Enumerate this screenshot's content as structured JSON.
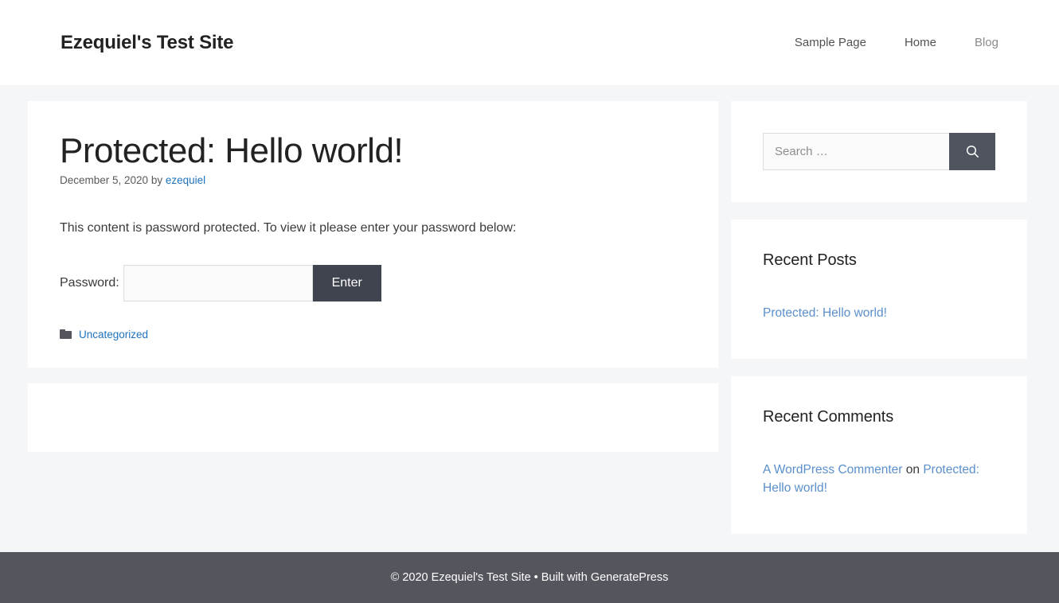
{
  "header": {
    "site_title": "Ezequiel's Test Site",
    "nav": [
      {
        "label": "Sample Page",
        "muted": false
      },
      {
        "label": "Home",
        "muted": false
      },
      {
        "label": "Blog",
        "muted": true
      }
    ]
  },
  "article": {
    "title": "Protected: Hello world!",
    "meta_date": "December 5, 2020",
    "meta_by": "by",
    "meta_author": "ezequiel",
    "protected_notice": "This content is password protected. To view it please enter your password below:",
    "password_label": "Password:",
    "password_value": "",
    "password_placeholder": "",
    "submit_label": "Enter",
    "category_icon": "folder-icon",
    "category_label": "Uncategorized"
  },
  "sidebar": {
    "search": {
      "placeholder": "Search …",
      "value": "",
      "button_icon": "search-icon"
    },
    "recent_posts": {
      "title": "Recent Posts",
      "items": [
        {
          "label": "Protected: Hello world!"
        }
      ]
    },
    "recent_comments": {
      "title": "Recent Comments",
      "items": [
        {
          "author": "A WordPress Commenter",
          "connector": "on",
          "post": "Protected: Hello world!"
        }
      ]
    }
  },
  "footer": {
    "copyright": "© 2020 Ezequiel's Test Site",
    "separator": "•",
    "built_with_prefix": "Built with",
    "built_with_link": "GeneratePress"
  },
  "colors": {
    "accent_link": "#1e73be",
    "sidebar_link": "#5a8fcc",
    "dark_button": "#3f444e",
    "search_button": "#4f545e",
    "footer_bg": "#55555e",
    "page_bg": "#f5f6f8"
  }
}
